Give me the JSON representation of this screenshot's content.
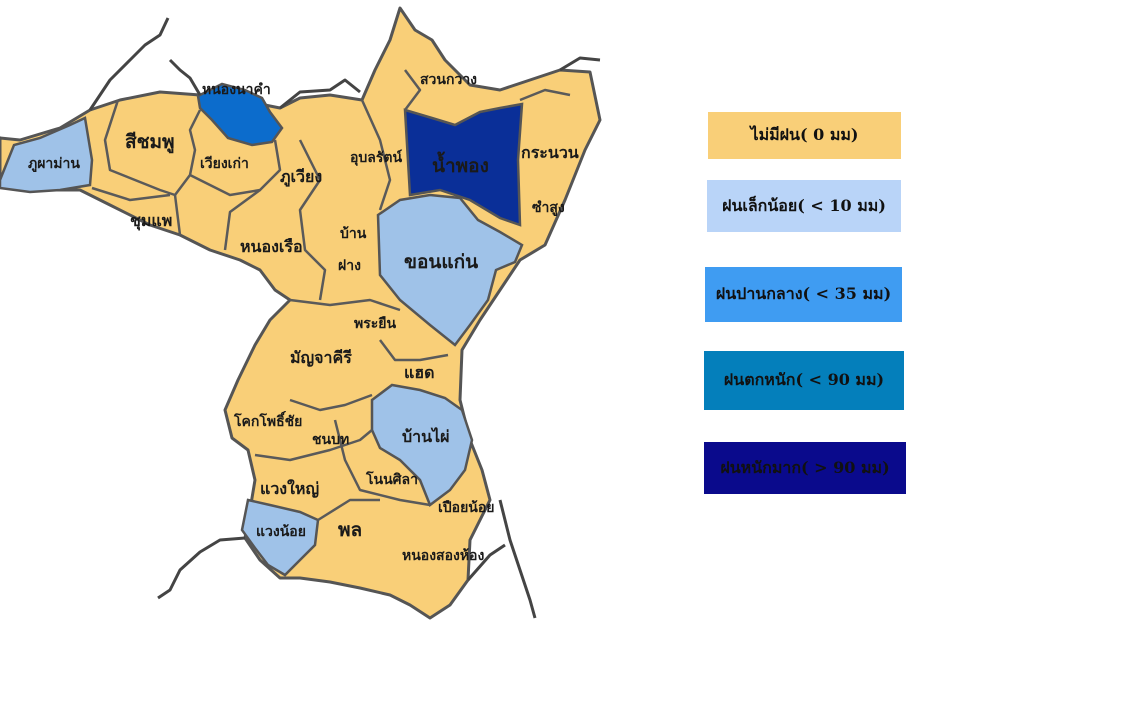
{
  "legend": [
    {
      "label": "ไม่มีฝน( 0 มม)",
      "color": "#f9cf78"
    },
    {
      "label": "ฝนเล็กน้อย( < 10 มม)",
      "color": "#b9d4f8"
    },
    {
      "label": "ฝนปานกลาง( < 35 มม)",
      "color": "#3f9cf2"
    },
    {
      "label": "ฝนตกหนัก( < 90 มม)",
      "color": "#047fbb"
    },
    {
      "label": "ฝนหนักมาก( > 90 มม)",
      "color": "#0a0a8c"
    }
  ],
  "districts": [
    {
      "id": "phu-pha-man",
      "name": "ภูผาม่าน",
      "category": "ฝนเล็กน้อย"
    },
    {
      "id": "si-chomphu",
      "name": "สีชมพู",
      "category": "ไม่มีฝน"
    },
    {
      "id": "nong-na-kham",
      "name": "หนองนาคำ",
      "category": "ฝนปานกลาง"
    },
    {
      "id": "wiang-kao",
      "name": "เวียงเก่า",
      "category": "ไม่มีฝน"
    },
    {
      "id": "phu-wiang",
      "name": "ภูเวียง",
      "category": "ไม่มีฝน"
    },
    {
      "id": "chum-phae",
      "name": "ชุมแพ",
      "category": "ไม่มีฝน"
    },
    {
      "id": "ubolratana",
      "name": "อุบลรัตน์",
      "category": "ไม่มีฝน"
    },
    {
      "id": "suan-kwang",
      "name": "สวนกวาง",
      "category": "ไม่มีฝน"
    },
    {
      "id": "nam-phong",
      "name": "น้ำพอง",
      "category": "ฝนหนักมาก"
    },
    {
      "id": "kranuan",
      "name": "กระนวน",
      "category": "ไม่มีฝน"
    },
    {
      "id": "sam-sung",
      "name": "ซำสูง",
      "category": "ไม่มีฝน"
    },
    {
      "id": "nong-ruea",
      "name": "หนองเรือ",
      "category": "ไม่มีฝน"
    },
    {
      "id": "ban-fang-1",
      "name": "บ้าน",
      "category": "ไม่มีฝน"
    },
    {
      "id": "ban-fang-2",
      "name": "ฝาง",
      "category": "ไม่มีฝน"
    },
    {
      "id": "khon-kaen",
      "name": "ขอนแก่น",
      "category": "ฝนเล็กน้อย"
    },
    {
      "id": "phra-yuen",
      "name": "พระยืน",
      "category": "ไม่มีฝน"
    },
    {
      "id": "mancha-khiri",
      "name": "มัญจาคีรี",
      "category": "ไม่มีฝน"
    },
    {
      "id": "haet",
      "name": "แฮด",
      "category": "ไม่มีฝน"
    },
    {
      "id": "khok-pho-chai",
      "name": "โคกโพธิ์ชัย",
      "category": "ไม่มีฝน"
    },
    {
      "id": "chonnabot",
      "name": "ชนบท",
      "category": "ไม่มีฝน"
    },
    {
      "id": "ban-phai",
      "name": "บ้านไผ่",
      "category": "ฝนเล็กน้อย"
    },
    {
      "id": "waeng-yai",
      "name": "แวงใหญ่",
      "category": "ไม่มีฝน"
    },
    {
      "id": "non-sila",
      "name": "โนนศิลา",
      "category": "ไม่มีฝน"
    },
    {
      "id": "pueai-noi",
      "name": "เปือยน้อย",
      "category": "ไม่มีฝน"
    },
    {
      "id": "waeng-noi",
      "name": "แวงน้อย",
      "category": "ฝนเล็กน้อย"
    },
    {
      "id": "phon",
      "name": "พล",
      "category": "ไม่มีฝน"
    },
    {
      "id": "nong-song-hong",
      "name": "หนองสองห้อง",
      "category": "ไม่มีฝน"
    }
  ]
}
